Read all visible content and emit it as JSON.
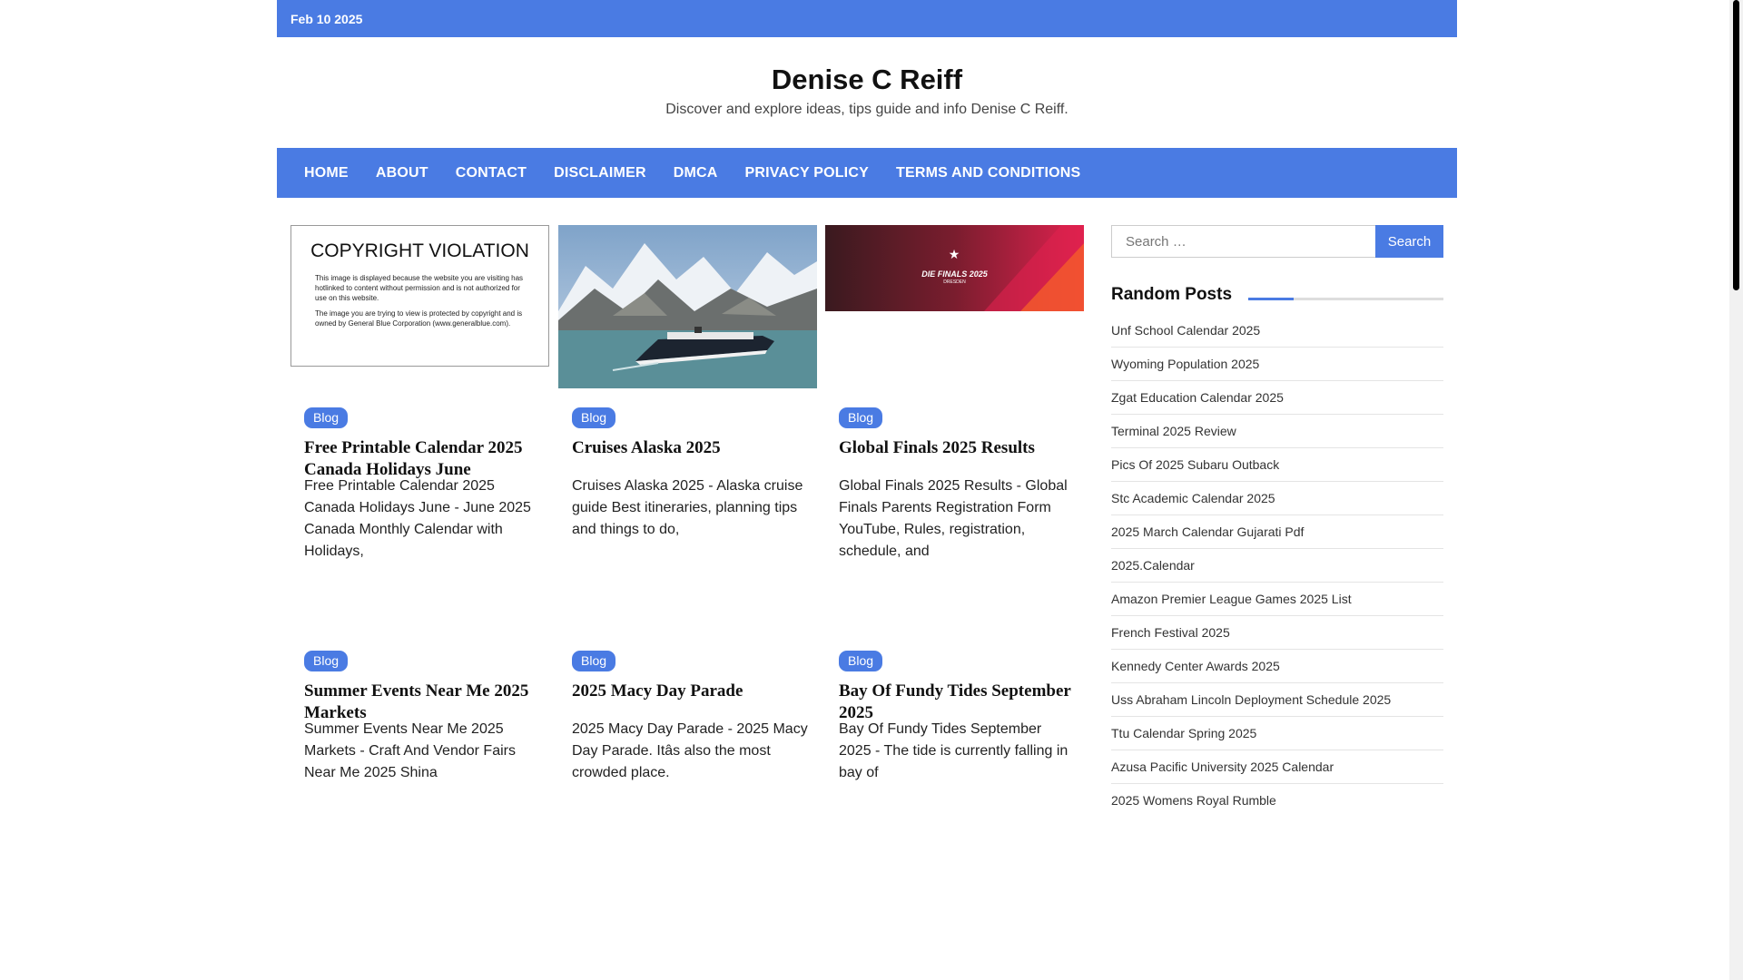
{
  "topbar": {
    "date": "Feb 10 2025"
  },
  "site": {
    "title": "Denise C Reiff",
    "description": "Discover and explore ideas, tips guide and info Denise C Reiff."
  },
  "nav": [
    "Home",
    "About",
    "Contact",
    "Disclaimer",
    "DMCA",
    "Privacy Policy",
    "Terms and Conditions"
  ],
  "posts": [
    {
      "category": "Blog",
      "title": "Free Printable Calendar 2025 Canada Holidays June",
      "excerpt": "Free Printable Calendar 2025 Canada Holidays June - June 2025 Canada Monthly Calendar with Holidays,",
      "thumb": {
        "heading": "COPYRIGHT VIOLATION",
        "line1": "This image is displayed because the website you are visiting has hotlinked to content without permission and is not authorized for use on this website.",
        "line2": "The image you are trying to view is protected by copyright and is owned by General Blue Corporation (www.generalblue.com)."
      }
    },
    {
      "category": "Blog",
      "title": "Cruises Alaska 2025",
      "excerpt": "Cruises Alaska 2025 - Alaska cruise guide Best itineraries, planning tips and things to do,"
    },
    {
      "category": "Blog",
      "title": "Global Finals 2025 Results",
      "excerpt": "Global Finals 2025 Results - Global Finals Parents Registration Form YouTube, Rules, registration, schedule, and",
      "thumb": {
        "logo_text": "DIE FINALS 2025",
        "logo_sub": "DRESDEN"
      }
    },
    {
      "category": "Blog",
      "title": "Summer Events Near Me 2025 Markets",
      "excerpt": "Summer Events Near Me 2025 Markets - Craft And Vendor Fairs Near Me 2025 Shina"
    },
    {
      "category": "Blog",
      "title": "2025 Macy Day Parade",
      "excerpt": "2025 Macy Day Parade - 2025 Macy Day Parade. Itâs also the most crowded place."
    },
    {
      "category": "Blog",
      "title": "Bay Of Fundy Tides September 2025",
      "excerpt": "Bay Of Fundy Tides September 2025 - The tide is currently falling in bay of"
    }
  ],
  "sidebar": {
    "search_placeholder": "Search …",
    "search_button": "Search",
    "random_posts_title": "Random Posts",
    "random_posts": [
      "Unf School Calendar 2025",
      "Wyoming Population 2025",
      "Zgat Education Calendar 2025",
      "Terminal 2025 Review",
      "Pics Of 2025 Subaru Outback",
      "Stc Academic Calendar 2025",
      "2025 March Calendar Gujarati Pdf",
      "2025.Calendar",
      "Amazon Premier League Games 2025 List",
      "French Festival 2025",
      "Kennedy Center Awards 2025",
      "Uss Abraham Lincoln Deployment Schedule 2025",
      "Ttu Calendar Spring 2025",
      "Azusa Pacific University 2025 Calendar",
      "2025 Womens Royal Rumble"
    ]
  },
  "colors": {
    "accent": "#4a7be3"
  }
}
